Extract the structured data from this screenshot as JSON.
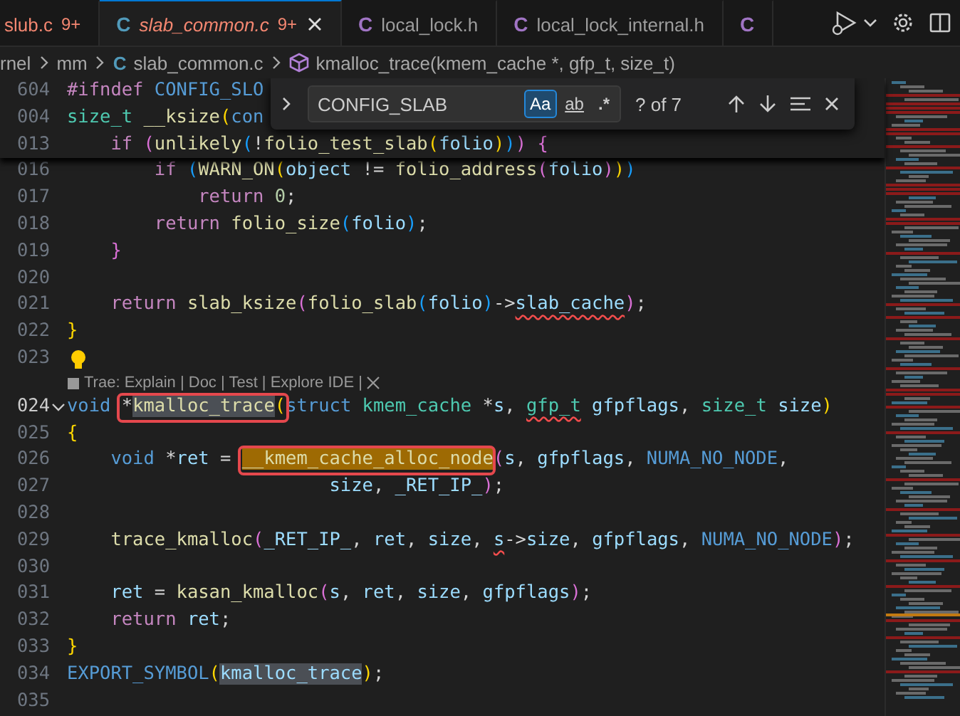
{
  "tabs": [
    {
      "label": "slub.c",
      "badge": "9+",
      "errors": true,
      "preview": false,
      "selected": false
    },
    {
      "icon": "C",
      "color": "#519aba",
      "label": "slab_common.c",
      "badge": "9+",
      "errors": true,
      "preview": true,
      "selected": true
    },
    {
      "icon": "C",
      "color": "#a074c4",
      "label": "local_lock.h",
      "errors": false,
      "preview": false,
      "selected": false
    },
    {
      "icon": "C",
      "color": "#a074c4",
      "label": "local_lock_internal.h",
      "errors": false,
      "preview": false,
      "selected": false
    },
    {
      "icon": "C",
      "color": "#a074c4",
      "selected": false
    }
  ],
  "breadcrumbs": [
    {
      "kind": "folder",
      "label": "rnel"
    },
    {
      "kind": "folder",
      "label": "mm"
    },
    {
      "kind": "file",
      "icon": "C",
      "label": "slab_common.c"
    },
    {
      "kind": "method",
      "label": "kmalloc_trace(kmem_cache *, gfp_t, size_t)"
    }
  ],
  "find": {
    "expanded": false,
    "value": "CONFIG_SLAB",
    "toggles": [
      {
        "kind": "case",
        "label": "Aa",
        "selected": true
      },
      {
        "kind": "word",
        "label": "ab",
        "selected": false
      },
      {
        "kind": "regex",
        "label": ".*",
        "selected": false
      }
    ],
    "result": "? of 7"
  },
  "sticky_lines": [
    {
      "number": "604",
      "tokens": [
        {
          "text": "#ifndef",
          "kind": "ctrl"
        },
        {
          "text": " CONFIG_SLO",
          "kind": "macro"
        }
      ]
    },
    {
      "number": "004",
      "tokens": [
        {
          "text": "size_t",
          "kind": "type"
        },
        {
          "text": " __ksize",
          "kind": "fn"
        },
        {
          "text": "(",
          "kind": "b1"
        },
        {
          "text": "con",
          "kind": "kw"
        }
      ]
    },
    {
      "number": "013",
      "tokens": [
        {
          "text": "    if",
          "kind": "ctrl"
        },
        {
          "text": " (",
          "kind": "b2"
        },
        {
          "text": "unlikely",
          "kind": "fn"
        },
        {
          "text": "(",
          "kind": "b3"
        },
        {
          "text": "!",
          "kind": "plain"
        },
        {
          "text": "folio_test_slab",
          "kind": "fn"
        },
        {
          "text": "(",
          "kind": "b1"
        },
        {
          "text": "folio",
          "kind": "var"
        },
        {
          "text": ")",
          "kind": "b1"
        },
        {
          "text": ")",
          "kind": "b3"
        },
        {
          "text": ")",
          "kind": "b2"
        },
        {
          "text": " {",
          "kind": "b2"
        }
      ]
    }
  ],
  "lines": [
    {
      "kind": "code",
      "number": "016",
      "current": false,
      "tokens": [
        {
          "text": "        if",
          "kind": "ctrl"
        },
        {
          "text": " (",
          "kind": "b3"
        },
        {
          "text": "WARN_ON",
          "kind": "fn"
        },
        {
          "text": "(",
          "kind": "b1"
        },
        {
          "text": "object",
          "kind": "var"
        },
        {
          "text": " != ",
          "kind": "plain"
        },
        {
          "text": "folio_address",
          "kind": "fn"
        },
        {
          "text": "(",
          "kind": "b2"
        },
        {
          "text": "folio",
          "kind": "var"
        },
        {
          "text": ")",
          "kind": "b2"
        },
        {
          "text": ")",
          "kind": "b1"
        },
        {
          "text": ")",
          "kind": "b3"
        }
      ]
    },
    {
      "kind": "code",
      "number": "017",
      "current": false,
      "tokens": [
        {
          "text": "            return",
          "kind": "ctrl"
        },
        {
          "text": " 0",
          "kind": "num"
        },
        {
          "text": ";",
          "kind": "plain"
        }
      ]
    },
    {
      "kind": "code",
      "number": "018",
      "current": false,
      "tokens": [
        {
          "text": "        return",
          "kind": "ctrl"
        },
        {
          "text": " folio_size",
          "kind": "fn"
        },
        {
          "text": "(",
          "kind": "b3"
        },
        {
          "text": "folio",
          "kind": "var"
        },
        {
          "text": ")",
          "kind": "b3"
        },
        {
          "text": ";",
          "kind": "plain"
        }
      ]
    },
    {
      "kind": "code",
      "number": "019",
      "current": false,
      "tokens": [
        {
          "text": "    }",
          "kind": "b2"
        }
      ]
    },
    {
      "kind": "code",
      "number": "020",
      "current": false
    },
    {
      "kind": "code",
      "number": "021",
      "current": false,
      "tokens": [
        {
          "text": "    return",
          "kind": "ctrl"
        },
        {
          "text": " slab_ksize",
          "kind": "fn"
        },
        {
          "text": "(",
          "kind": "b2"
        },
        {
          "text": "folio_slab",
          "kind": "fn"
        },
        {
          "text": "(",
          "kind": "b3"
        },
        {
          "text": "folio",
          "kind": "var"
        },
        {
          "text": ")",
          "kind": "b3"
        },
        {
          "text": "->",
          "kind": "plain"
        },
        {
          "text": "slab_cache",
          "kind": "var",
          "squiggle": true
        },
        {
          "text": ")",
          "kind": "b2"
        },
        {
          "text": ";",
          "kind": "plain"
        }
      ]
    },
    {
      "kind": "code",
      "number": "022",
      "current": false,
      "tokens": [
        {
          "text": "}",
          "kind": "b1"
        }
      ]
    },
    {
      "kind": "code",
      "number": "023",
      "current": false,
      "lightbulb": true
    },
    {
      "kind": "codelens",
      "text": "Trae: Explain | Doc | Test | Explore IDE |"
    },
    {
      "kind": "code",
      "number": "024",
      "current": true,
      "expanded": true,
      "tokens": [
        {
          "text": "void ",
          "kind": "kw"
        },
        {
          "text": "*",
          "kind": "plain",
          "boxed": true
        },
        {
          "text": "kmalloc_trace",
          "kind": "fn",
          "occurrence": true,
          "boxed": true
        },
        {
          "text": "(",
          "kind": "b1",
          "boxed": true
        },
        {
          "text": "struct",
          "kind": "kw"
        },
        {
          "text": " kmem_cache",
          "kind": "type"
        },
        {
          "text": " *",
          "kind": "plain"
        },
        {
          "text": "s",
          "kind": "var"
        },
        {
          "text": ", ",
          "kind": "plain"
        },
        {
          "text": "gfp_t",
          "kind": "type",
          "squiggle": true
        },
        {
          "text": " gfpflags",
          "kind": "var"
        },
        {
          "text": ", ",
          "kind": "plain"
        },
        {
          "text": "size_t",
          "kind": "type"
        },
        {
          "text": " size",
          "kind": "var"
        },
        {
          "text": ")",
          "kind": "b1"
        }
      ]
    },
    {
      "kind": "code",
      "number": "025",
      "current": false,
      "tokens": [
        {
          "text": "{",
          "kind": "b1"
        }
      ]
    },
    {
      "kind": "code",
      "number": "026",
      "current": false,
      "tokens": [
        {
          "text": "    void",
          "kind": "kw"
        },
        {
          "text": " *",
          "kind": "plain"
        },
        {
          "text": "ret",
          "kind": "var"
        },
        {
          "text": " = ",
          "kind": "plain"
        },
        {
          "text": "__kmem_cache_alloc_node",
          "kind": "fn",
          "match": true,
          "boxed": true
        },
        {
          "text": "(",
          "kind": "b2"
        },
        {
          "text": "s",
          "kind": "var"
        },
        {
          "text": ", ",
          "kind": "plain"
        },
        {
          "text": "gfpflags",
          "kind": "var"
        },
        {
          "text": ", ",
          "kind": "plain"
        },
        {
          "text": "NUMA_NO_NODE",
          "kind": "macro"
        },
        {
          "text": ",",
          "kind": "plain"
        }
      ]
    },
    {
      "kind": "code",
      "number": "027",
      "current": false,
      "tokens": [
        {
          "text": "                        size",
          "kind": "var"
        },
        {
          "text": ", ",
          "kind": "plain"
        },
        {
          "text": "_RET_IP_",
          "kind": "var"
        },
        {
          "text": ")",
          "kind": "b2"
        },
        {
          "text": ";",
          "kind": "plain"
        }
      ]
    },
    {
      "kind": "code",
      "number": "028",
      "current": false
    },
    {
      "kind": "code",
      "number": "029",
      "current": false,
      "tokens": [
        {
          "text": "    trace_kmalloc",
          "kind": "fn"
        },
        {
          "text": "(",
          "kind": "b2"
        },
        {
          "text": "_RET_IP_",
          "kind": "var"
        },
        {
          "text": ", ",
          "kind": "plain"
        },
        {
          "text": "ret",
          "kind": "var"
        },
        {
          "text": ", ",
          "kind": "plain"
        },
        {
          "text": "size",
          "kind": "var"
        },
        {
          "text": ", ",
          "kind": "plain"
        },
        {
          "text": "s",
          "kind": "var",
          "squiggle": true
        },
        {
          "text": "->",
          "kind": "plain"
        },
        {
          "text": "size",
          "kind": "var"
        },
        {
          "text": ", ",
          "kind": "plain"
        },
        {
          "text": "gfpflags",
          "kind": "var"
        },
        {
          "text": ", ",
          "kind": "plain"
        },
        {
          "text": "NUMA_NO_NODE",
          "kind": "macro"
        },
        {
          "text": ")",
          "kind": "b2"
        },
        {
          "text": ";",
          "kind": "plain"
        }
      ]
    },
    {
      "kind": "code",
      "number": "030",
      "current": false
    },
    {
      "kind": "code",
      "number": "031",
      "current": false,
      "tokens": [
        {
          "text": "    ret",
          "kind": "var"
        },
        {
          "text": " = ",
          "kind": "plain"
        },
        {
          "text": "kasan_kmalloc",
          "kind": "fn"
        },
        {
          "text": "(",
          "kind": "b2"
        },
        {
          "text": "s",
          "kind": "var"
        },
        {
          "text": ", ",
          "kind": "plain"
        },
        {
          "text": "ret",
          "kind": "var"
        },
        {
          "text": ", ",
          "kind": "plain"
        },
        {
          "text": "size",
          "kind": "var"
        },
        {
          "text": ", ",
          "kind": "plain"
        },
        {
          "text": "gfpflags",
          "kind": "var"
        },
        {
          "text": ")",
          "kind": "b2"
        },
        {
          "text": ";",
          "kind": "plain"
        }
      ]
    },
    {
      "kind": "code",
      "number": "032",
      "current": false,
      "tokens": [
        {
          "text": "    return",
          "kind": "ctrl"
        },
        {
          "text": " ret",
          "kind": "var"
        },
        {
          "text": ";",
          "kind": "plain"
        }
      ]
    },
    {
      "kind": "code",
      "number": "033",
      "current": false,
      "tokens": [
        {
          "text": "}",
          "kind": "b1"
        }
      ]
    },
    {
      "kind": "code",
      "number": "034",
      "current": false,
      "tokens": [
        {
          "text": "EXPORT_SYMBOL",
          "kind": "macro"
        },
        {
          "text": "(",
          "kind": "b1"
        },
        {
          "text": "kmalloc_trace",
          "kind": "var",
          "occurrence": true
        },
        {
          "text": ")",
          "kind": "b1"
        },
        {
          "text": ";",
          "kind": "plain"
        }
      ]
    },
    {
      "kind": "code",
      "number": "035",
      "current": false
    }
  ]
}
